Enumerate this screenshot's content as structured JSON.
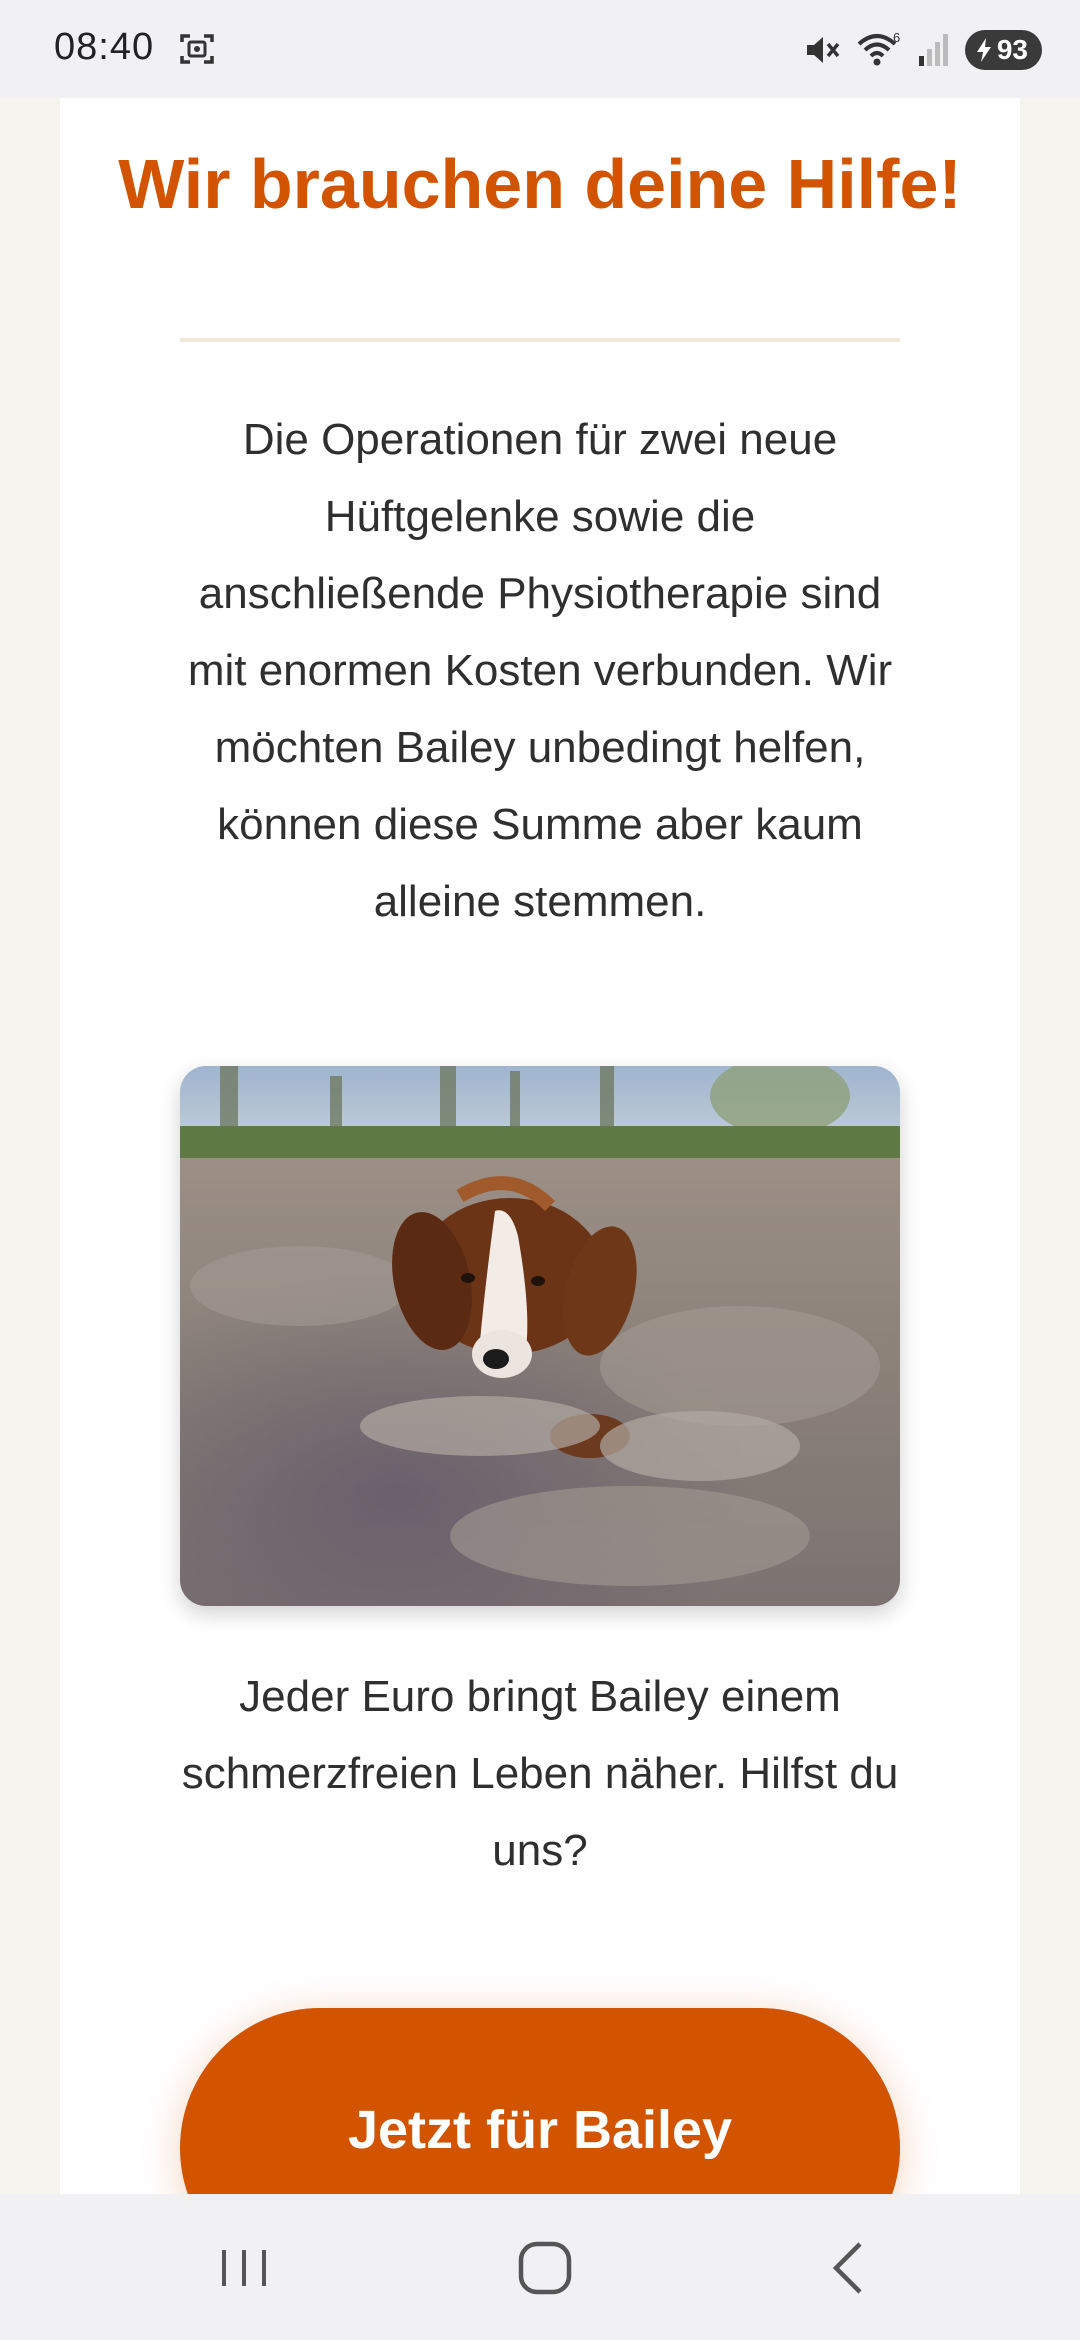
{
  "status_bar": {
    "time": "08:40",
    "icons": [
      "screen-record-icon",
      "mute-icon",
      "wifi-icon",
      "signal-icon"
    ],
    "wifi_badge": "6",
    "battery_level": "93"
  },
  "content": {
    "headline": "Wir brauchen deine Hilfe!",
    "paragraph_1": "Die Operationen für zwei neue Hüftgelenke sowie die anschließende Physiotherapie sind mit enormen Kosten verbunden. Wir möchten Bailey unbedingt helfen, können diese Summe aber kaum alleine stemmen.",
    "photo_icon": "dog-photo",
    "paragraph_2": "Jeder Euro bringt Bailey einem schmerzfreien Leben näher. Hilfst du uns?",
    "donate_button": "Jetzt für Bailey spenden"
  },
  "nav_bar": {
    "icons": [
      "recent-apps-icon",
      "home-icon",
      "back-icon"
    ]
  },
  "colors": {
    "accent": "#d35400",
    "page_background": "#f6f4ef",
    "card_background": "#ffffff",
    "text": "#2f2f2f",
    "divider": "#efe8d4"
  }
}
